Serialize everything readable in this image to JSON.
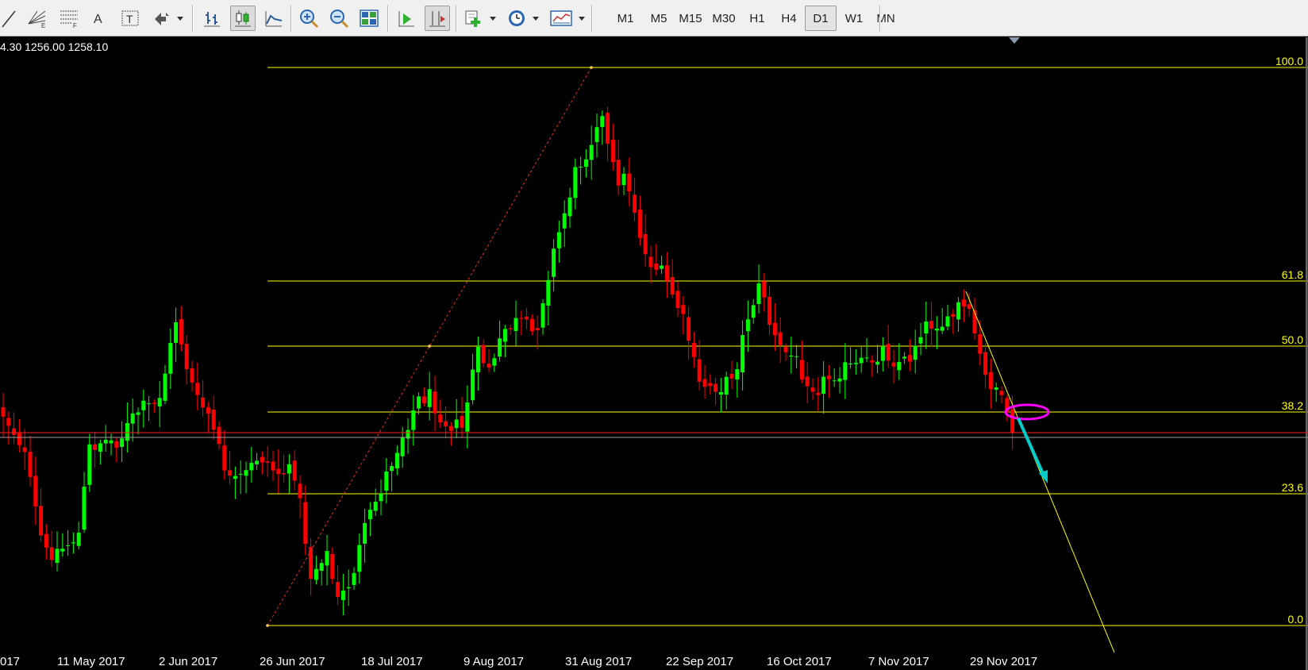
{
  "toolbar": {
    "tools": [
      {
        "name": "trendline-tool-icon"
      },
      {
        "name": "fibonacci-fan-tool-icon",
        "sub": "E"
      },
      {
        "name": "fibonacci-tool-icon",
        "sub": "F"
      },
      {
        "name": "text-tool-icon",
        "label": "A"
      },
      {
        "name": "text-label-tool-icon",
        "label": "T"
      },
      {
        "name": "arrows-tool-icon"
      },
      {
        "name": "bar-chart-icon"
      },
      {
        "name": "candlestick-chart-icon"
      },
      {
        "name": "line-chart-icon"
      },
      {
        "name": "zoom-in-icon"
      },
      {
        "name": "zoom-out-icon"
      },
      {
        "name": "tile-windows-icon"
      },
      {
        "name": "autoscroll-icon"
      },
      {
        "name": "chart-shift-icon"
      },
      {
        "name": "indicators-icon"
      },
      {
        "name": "periods-clock-icon"
      },
      {
        "name": "templates-icon"
      }
    ],
    "timeframes": [
      "M1",
      "M5",
      "M15",
      "M30",
      "H1",
      "H4",
      "D1",
      "W1",
      "MN"
    ],
    "active_timeframe": "D1"
  },
  "chart": {
    "ohlc_text": "4.30 1256.00 1258.10",
    "fib_levels": [
      "100.0",
      "61.8",
      "50.0",
      "38.2",
      "23.6",
      "0.0"
    ],
    "dates": [
      "017",
      "11 May 2017",
      "2 Jun 2017",
      "26 Jun 2017",
      "18 Jul 2017",
      "9 Aug 2017",
      "31 Aug 2017",
      "22 Sep 2017",
      "16 Oct 2017",
      "7 Nov 2017",
      "29 Nov 2017"
    ],
    "colors": {
      "background": "#000000",
      "bull": "#00ff00",
      "bear": "#ff0000",
      "fib": "#ffff00",
      "bid_line": "#ff0000",
      "ask_line": "#c0c0c0",
      "ellipse": "#ff00ff",
      "arrow": "#00cccc"
    }
  }
}
